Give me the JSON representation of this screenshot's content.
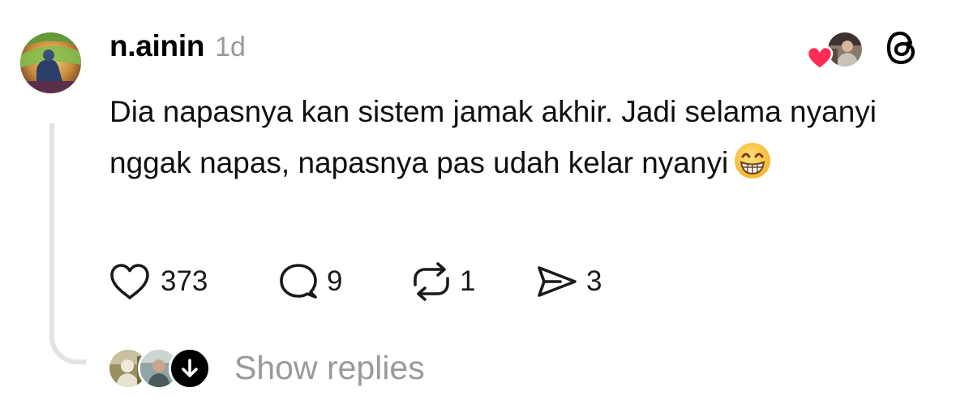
{
  "post": {
    "author": {
      "username": "n.ainin",
      "timestamp": "1d",
      "avatar_icon": "avatar-photo-icon"
    },
    "liked_by_author_indicator": {
      "heart_color": "#ff2d55",
      "avatar_icon": "avatar-photo-icon"
    },
    "app_icon": "threads-logo-icon",
    "body": {
      "text": "Dia napasnya kan sistem jamak akhir. Jadi selama nyanyi nggak napas, napasnya pas udah kelar nyanyi",
      "emoji": "😁"
    },
    "actions": {
      "like": {
        "icon": "heart-icon",
        "count": "373"
      },
      "reply": {
        "icon": "comment-icon",
        "count": "9"
      },
      "repost": {
        "icon": "repost-icon",
        "count": "1"
      },
      "share": {
        "icon": "send-icon",
        "count": "3"
      }
    },
    "replies": {
      "label": "Show replies",
      "expand_icon": "arrow-down-icon"
    }
  },
  "colors": {
    "text": "#101010",
    "secondary_text": "#9a9a9a",
    "thread_line": "#e3e3e3",
    "heart": "#ff2d55"
  }
}
